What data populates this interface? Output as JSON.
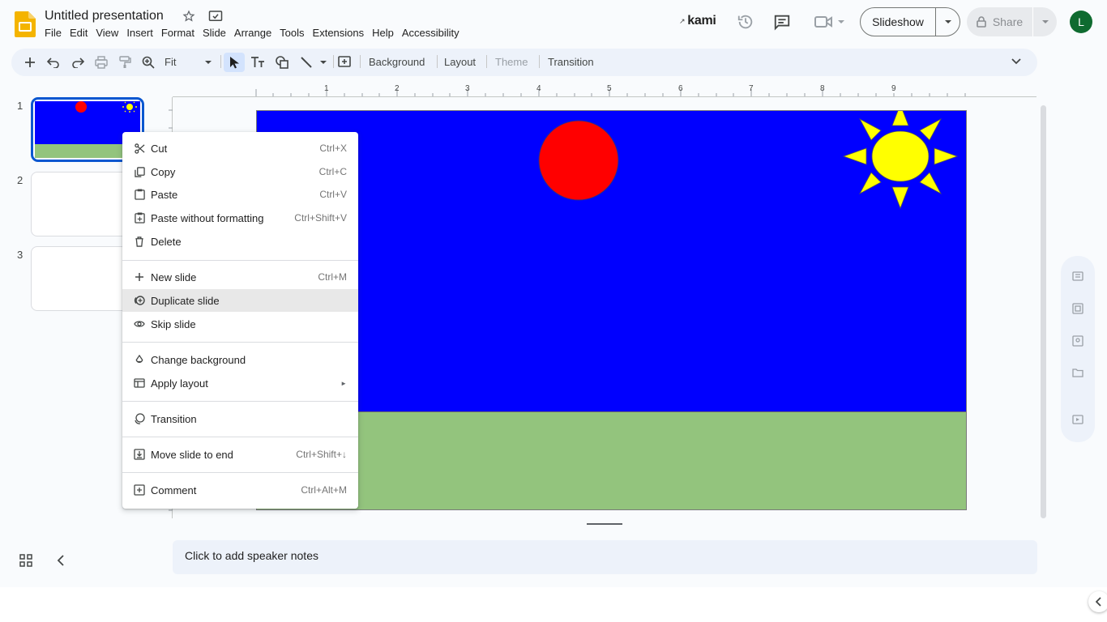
{
  "header": {
    "title": "Untitled presentation",
    "menus": [
      "File",
      "Edit",
      "View",
      "Insert",
      "Format",
      "Slide",
      "Arrange",
      "Tools",
      "Extensions",
      "Help",
      "Accessibility"
    ],
    "kami_label": "kami",
    "slideshow_label": "Slideshow",
    "share_label": "Share",
    "avatar_initial": "L"
  },
  "toolbar": {
    "zoom_label": "Fit",
    "background_label": "Background",
    "layout_label": "Layout",
    "theme_label": "Theme",
    "transition_label": "Transition"
  },
  "filmstrip": {
    "slides": [
      {
        "number": "1",
        "selected": true
      },
      {
        "number": "2",
        "selected": false
      },
      {
        "number": "3",
        "selected": false
      }
    ]
  },
  "ruler": {
    "numbers": [
      "1",
      "2",
      "3",
      "4",
      "5",
      "6",
      "7",
      "8",
      "9"
    ]
  },
  "context_menu": {
    "items": [
      {
        "label": "Cut",
        "shortcut": "Ctrl+X",
        "icon": "scissors-icon"
      },
      {
        "label": "Copy",
        "shortcut": "Ctrl+C",
        "icon": "copy-icon"
      },
      {
        "label": "Paste",
        "shortcut": "Ctrl+V",
        "icon": "clipboard-icon"
      },
      {
        "label": "Paste without formatting",
        "shortcut": "Ctrl+Shift+V",
        "icon": "clipboard-plain-icon"
      },
      {
        "label": "Delete",
        "shortcut": "",
        "icon": "trash-icon"
      },
      {
        "label": "New slide",
        "shortcut": "Ctrl+M",
        "icon": "plus-icon"
      },
      {
        "label": "Duplicate slide",
        "shortcut": "",
        "icon": "duplicate-icon",
        "highlighted": true
      },
      {
        "label": "Skip slide",
        "shortcut": "",
        "icon": "eye-icon"
      },
      {
        "label": "Change background",
        "shortcut": "",
        "icon": "drop-icon"
      },
      {
        "label": "Apply layout",
        "shortcut": "",
        "icon": "layout-icon",
        "submenu": true
      },
      {
        "label": "Transition",
        "shortcut": "",
        "icon": "transition-icon"
      },
      {
        "label": "Move slide to end",
        "shortcut": "Ctrl+Shift+↓",
        "icon": "move-down-icon"
      },
      {
        "label": "Comment",
        "shortcut": "Ctrl+Alt+M",
        "icon": "comment-add-icon"
      }
    ]
  },
  "notes": {
    "placeholder": "Click to add speaker notes"
  },
  "slide_content": {
    "background_color": "#0000ff",
    "ground_color": "#93c47d",
    "circle_color": "#ff0000",
    "sun_color": "#ffff00"
  },
  "colors": {
    "accent": "#0b57d0",
    "avatar_bg": "#0f6b30"
  }
}
